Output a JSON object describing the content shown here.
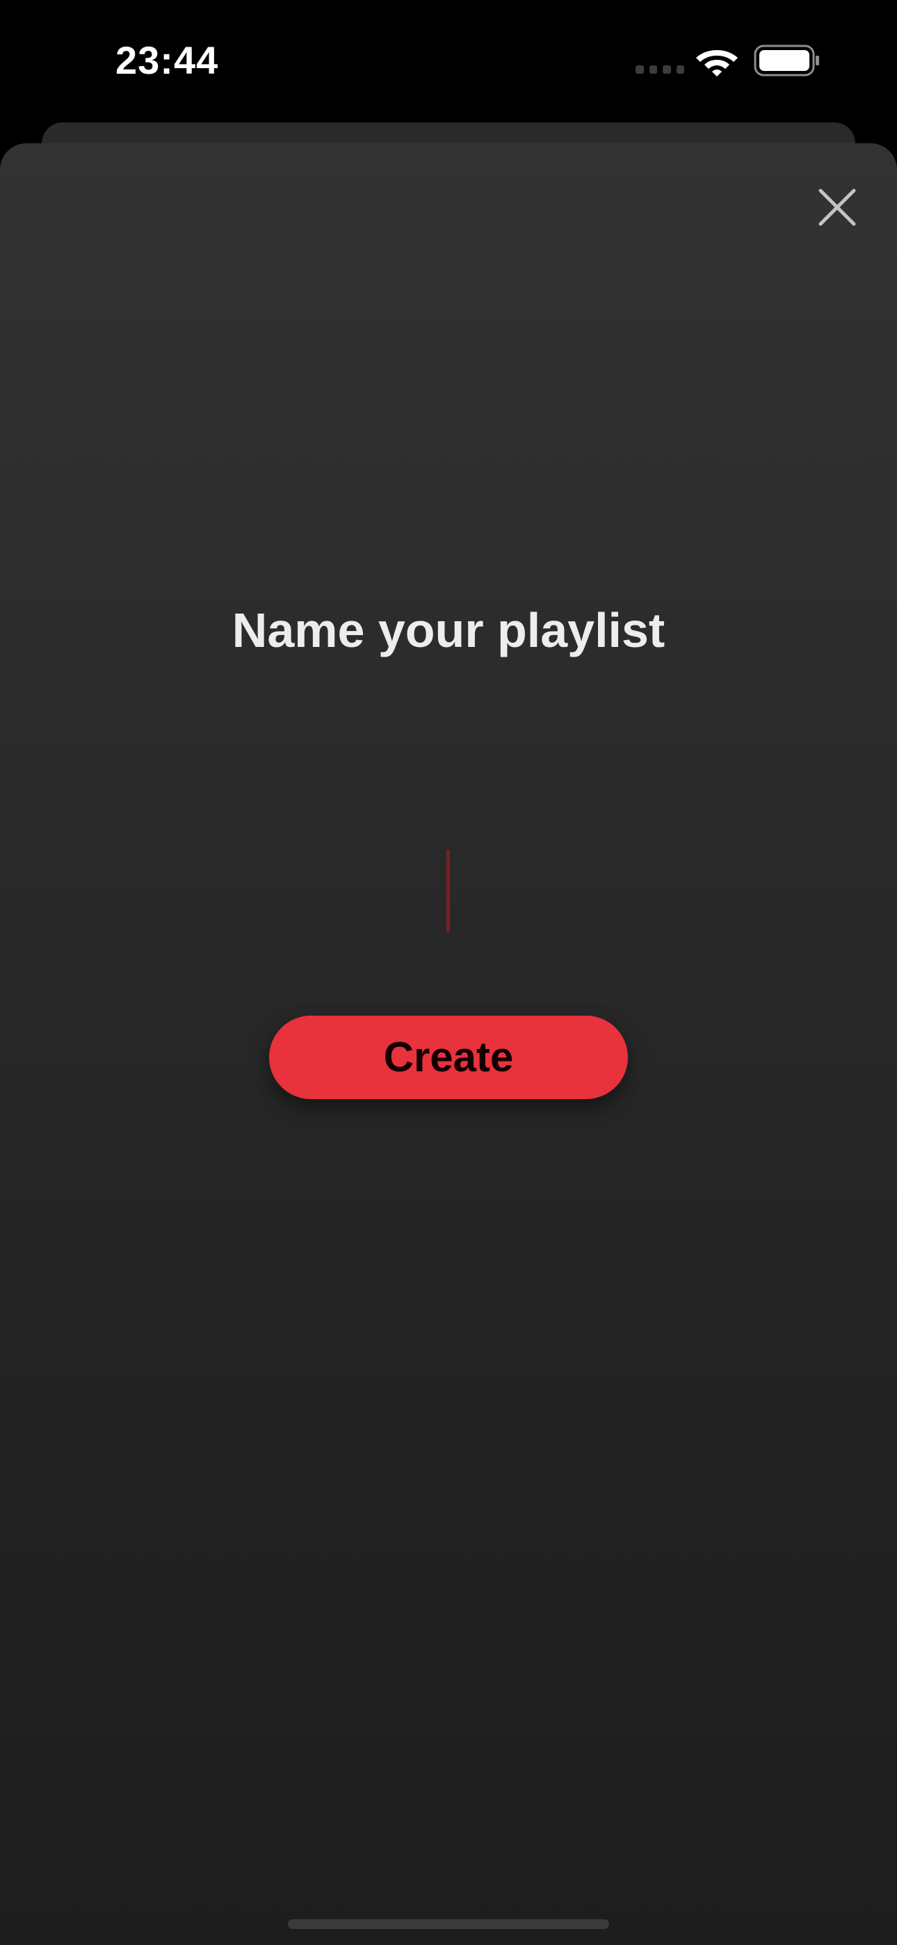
{
  "status_bar": {
    "time": "23:44",
    "icons": [
      "signal-dots-icon",
      "wifi-icon",
      "battery-icon"
    ]
  },
  "modal": {
    "title": "Name your playlist",
    "close_icon": "close-icon",
    "input": {
      "value": "",
      "placeholder": ""
    },
    "create_label": "Create"
  },
  "colors": {
    "accent": "#e8323c",
    "cursor": "#7a1f24",
    "sheet_top": "#333333",
    "sheet_bottom": "#1d1d1d",
    "title_text": "#ededed"
  }
}
